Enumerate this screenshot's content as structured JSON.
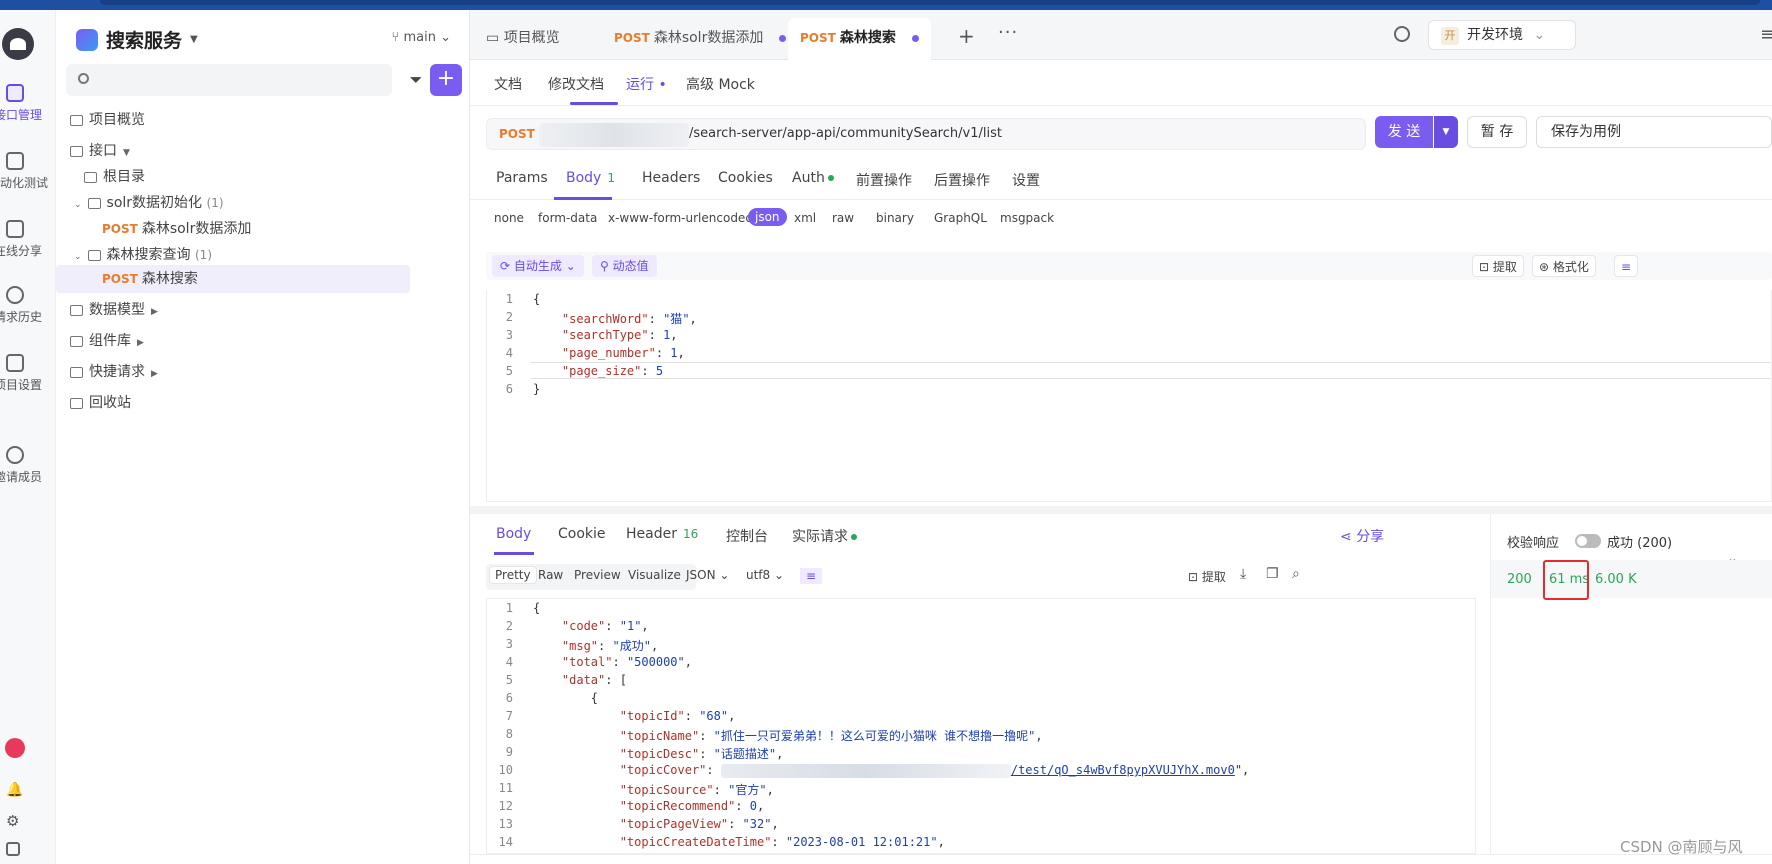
{
  "rail": {
    "items": [
      "接口管理",
      "自动化测试",
      "在线分享",
      "请求历史",
      "项目设置",
      "邀请成员"
    ]
  },
  "sidebar": {
    "project_name": "搜索服务",
    "branch": "main",
    "search_placeholder": "",
    "tree": {
      "overview": "项目概览",
      "interfaces": "接口",
      "root": "根目录",
      "folder1": "solr数据初始化",
      "folder1_count": "(1)",
      "api1_method": "POST",
      "api1_name": "森林solr数据添加",
      "folder2": "森林搜索查询",
      "folder2_count": "(1)",
      "api2_method": "POST",
      "api2_name": "森林搜索",
      "models": "数据模型",
      "components": "组件库",
      "quick": "快捷请求",
      "trash": "回收站"
    }
  },
  "tabs": {
    "overview": "项目概览",
    "tab2_method": "POST",
    "tab2_name": "森林solr数据添加",
    "tab3_method": "POST",
    "tab3_name": "森林搜索",
    "env": "开发环境",
    "env_badge": "开"
  },
  "subnav": [
    "文档",
    "修改文档",
    "运行",
    "高级 Mock"
  ],
  "request": {
    "method": "POST",
    "url": "/search-server/app-api/communitySearch/v1/list",
    "send": "发 送",
    "save": "暂 存",
    "save_as": "保存为用例"
  },
  "req_tabs": {
    "params": "Params",
    "body": "Body",
    "body_count": "1",
    "headers": "Headers",
    "cookies": "Cookies",
    "auth": "Auth",
    "pre": "前置操作",
    "post": "后置操作",
    "settings": "设置"
  },
  "body_types": [
    "none",
    "form-data",
    "x-www-form-urlencoded",
    "json",
    "xml",
    "raw",
    "binary",
    "GraphQL",
    "msgpack"
  ],
  "editor": {
    "auto_gen": "自动生成",
    "dynamic": "动态值",
    "extract": "提取",
    "format": "格式化"
  },
  "request_body": {
    "searchWord": "猫",
    "searchType": 1,
    "page_number": 1,
    "page_size": 5
  },
  "resp_tabs": {
    "body": "Body",
    "cookie": "Cookie",
    "header": "Header",
    "header_count": "16",
    "console": "控制台",
    "actual": "实际请求",
    "share": "分享"
  },
  "resp_format": {
    "views": [
      "Pretty",
      "Raw",
      "Preview",
      "Visualize"
    ],
    "type": "JSON",
    "encoding": "utf8",
    "extract": "提取"
  },
  "response": {
    "code": "1",
    "msg": "成功",
    "total": "500000",
    "topicId": "68",
    "topicName": "抓住一只可爱弟弟！！这么可爱的小猫咪 谁不想撸一撸呢",
    "topicDesc": "话题描述",
    "topicCover_tail": "/test/qO_s4wBvf8pypXVUJYhX.mov0",
    "topicSource": "官方",
    "topicRecommend": 0,
    "topicPageView": "32",
    "topicCreateDateTime": "2023-08-01 12:01:21"
  },
  "check": {
    "label": "校验响应",
    "result": "成功 (200)",
    "status": "200",
    "time": "61 ms",
    "size": "6.00 K"
  },
  "watermark": "CSDN @南顾与风"
}
